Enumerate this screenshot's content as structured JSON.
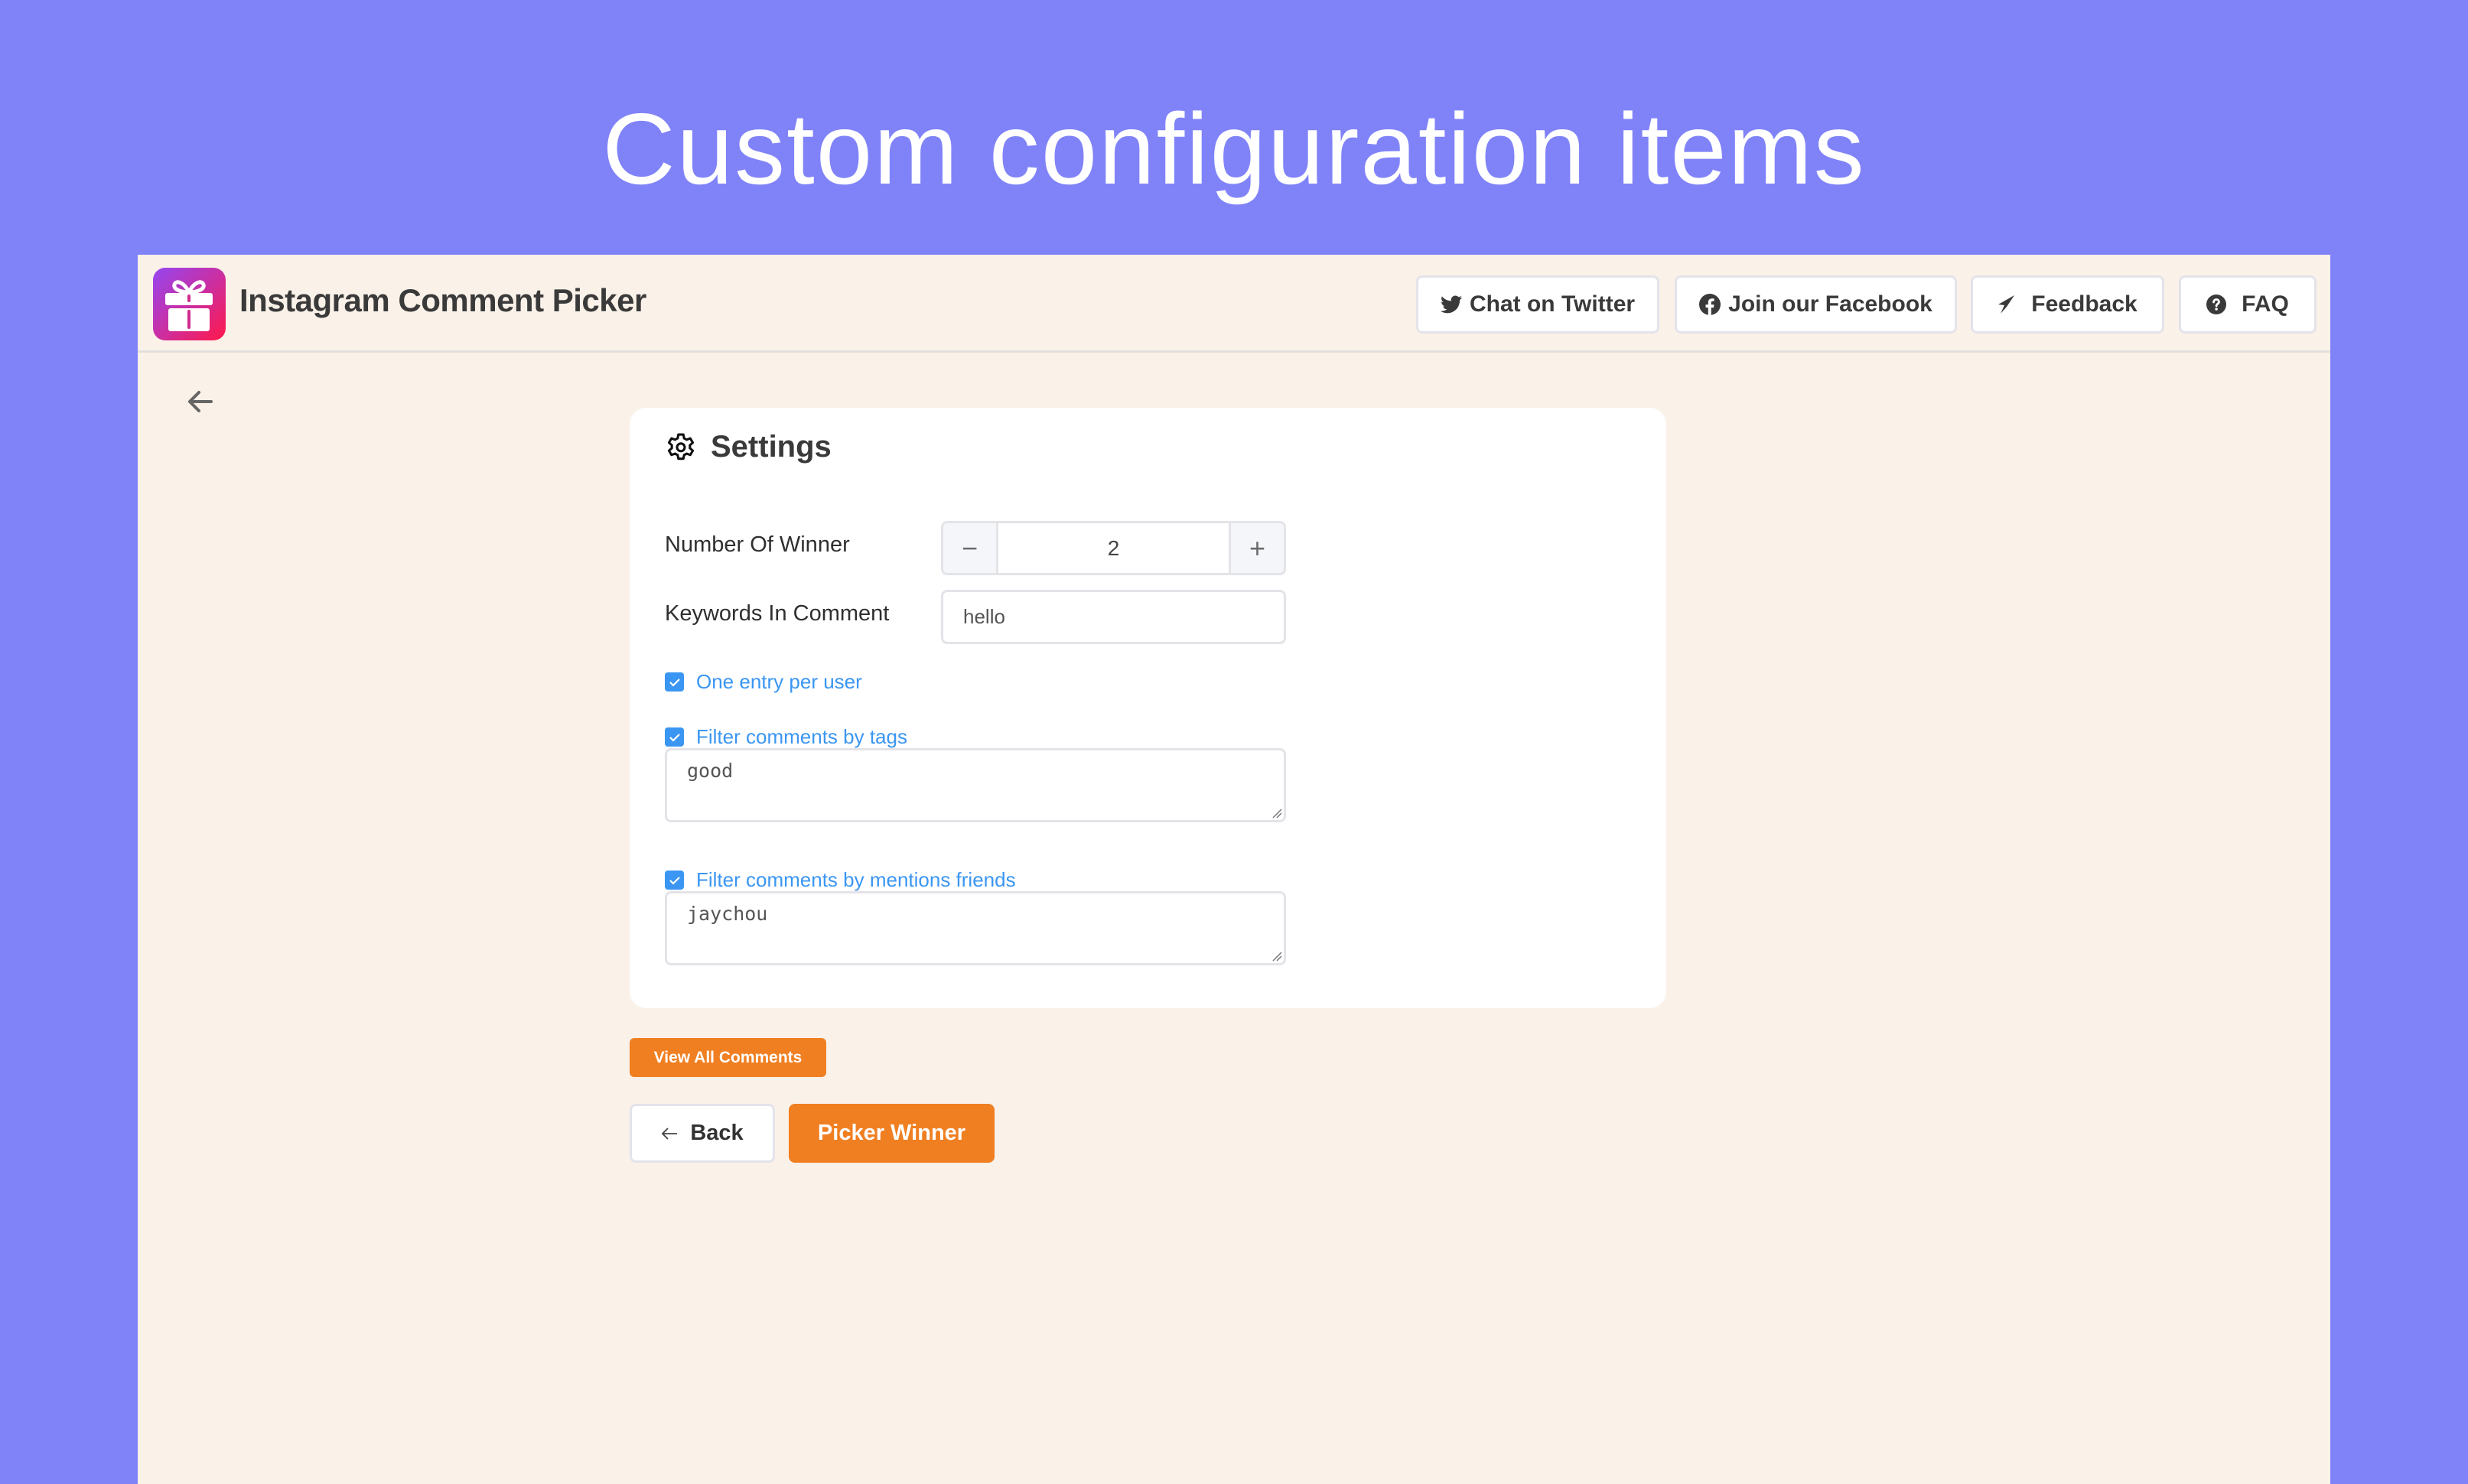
{
  "banner": {
    "title": "Custom configuration items"
  },
  "header": {
    "app_title": "Instagram Comment Picker",
    "logo_icon": "gift-icon",
    "nav": [
      {
        "label": "Chat on Twitter",
        "icon": "twitter-icon"
      },
      {
        "label": "Join our Facebook",
        "icon": "facebook-icon"
      },
      {
        "label": "Feedback",
        "icon": "paper-plane-icon"
      },
      {
        "label": "FAQ",
        "icon": "question-circle-icon"
      }
    ]
  },
  "page": {
    "back_icon": "arrow-left-icon"
  },
  "settings": {
    "title": "Settings",
    "icon": "gear-icon",
    "number_of_winner": {
      "label": "Number Of Winner",
      "value": "2",
      "decrement_symbol": "−",
      "increment_symbol": "+"
    },
    "keywords": {
      "label": "Keywords In Comment",
      "value": "hello"
    },
    "options": [
      {
        "label": "One entry per user",
        "checked": true
      },
      {
        "label": "Filter comments by tags",
        "checked": true,
        "textarea_value": "good"
      },
      {
        "label": "Filter comments by mentions friends",
        "checked": true,
        "textarea_value": "jaychou"
      }
    ]
  },
  "actions": {
    "view_all_comments": "View All Comments",
    "back": "Back",
    "picker_winner": "Picker Winner"
  },
  "colors": {
    "background": "#8083f8",
    "app_background": "#faf1e8",
    "accent_orange": "#f07f21",
    "checkbox_blue": "#3a96f2",
    "text_dark": "#3a3a3a"
  }
}
